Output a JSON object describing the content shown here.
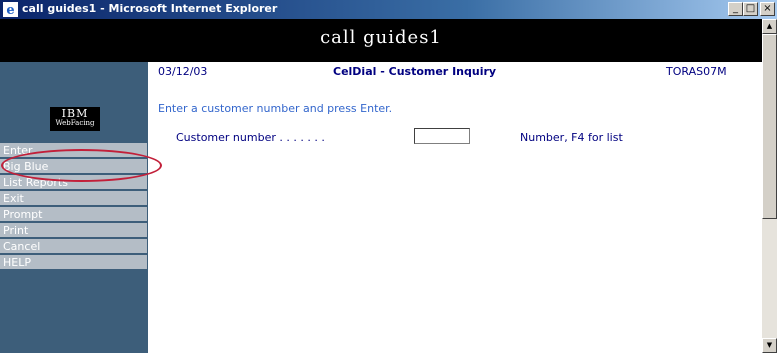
{
  "window": {
    "title": "call guides1 - Microsoft Internet Explorer",
    "buttons": {
      "minimize": "_",
      "maximize": "□",
      "close": "×"
    }
  },
  "app": {
    "title": "call guides1"
  },
  "logo": {
    "line1": "IBM",
    "line2": "WebFacing"
  },
  "sidebar": {
    "items": [
      {
        "label": "Enter"
      },
      {
        "label": "Big Blue"
      },
      {
        "label": "List Reports"
      },
      {
        "label": "Exit"
      },
      {
        "label": "Prompt"
      },
      {
        "label": "Print"
      },
      {
        "label": "Cancel"
      },
      {
        "label": "HELP"
      }
    ]
  },
  "screen": {
    "date": "03/12/03",
    "title": "CelDial - Customer Inquiry",
    "program": "TORAS07M",
    "instruction": "Enter a customer number and press Enter.",
    "field": {
      "label": "Customer number . . . . . . .",
      "value": "",
      "hint": "Number, F4 for list"
    }
  },
  "colors": {
    "sidebar": "#3d5e7a",
    "command_button": "#b4bdc6",
    "highlight_ring": "#c21f39",
    "screen_text": "#000080",
    "instruction_text": "#3366cc"
  }
}
